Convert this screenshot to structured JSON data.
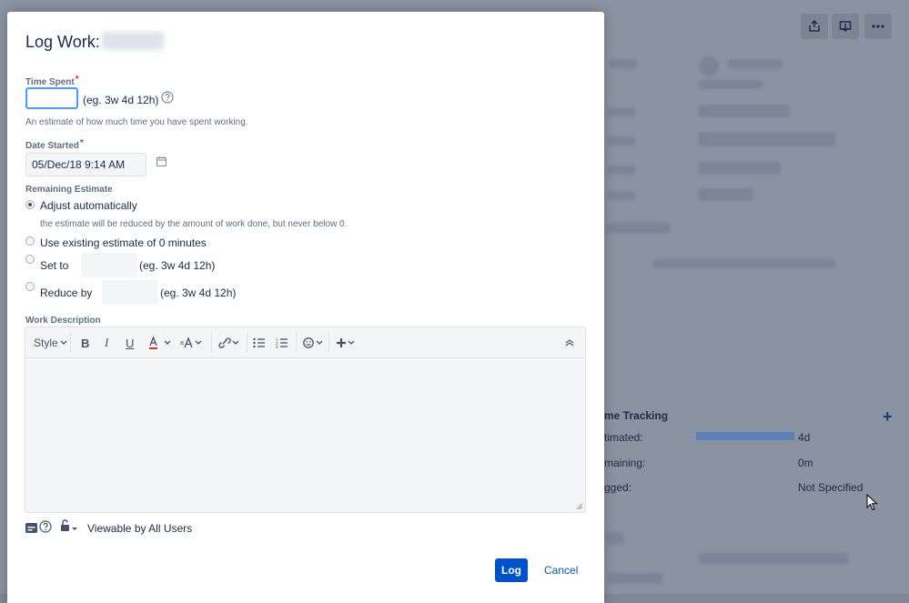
{
  "background": {
    "time_tracking_heading": "me Tracking",
    "rows": [
      {
        "label": "timated:",
        "value": "4d"
      },
      {
        "label": "maining:",
        "value": "0m"
      },
      {
        "label": "gged:",
        "value": "Not Specified"
      }
    ],
    "estimated_fill": 1.0
  },
  "dialog": {
    "title": "Log Work:",
    "time_spent": {
      "label": "Time Spent",
      "required_mark": "*",
      "value": "",
      "hint": "(eg. 3w 4d 12h)",
      "description": "An estimate of how much time you have spent working."
    },
    "date_started": {
      "label": "Date Started",
      "required_mark": "*",
      "value": "05/Dec/18 9:14 AM"
    },
    "remaining_estimate": {
      "label": "Remaining Estimate",
      "options": [
        {
          "label": "Adjust automatically",
          "checked": true
        },
        {
          "label": "Use existing estimate of 0 minutes",
          "checked": false
        },
        {
          "label": "Set to",
          "checked": false
        },
        {
          "label": "Reduce by",
          "checked": false
        }
      ],
      "adjust_note": "the estimate will be reduced by the amount of work done, but never below 0.",
      "set_hint": "(eg. 3w 4d 12h)",
      "reduce_hint": "(eg. 3w 4d 12h)"
    },
    "work_description": {
      "label": "Work Description",
      "toolbar": {
        "style_label": "Style",
        "icons": [
          "bold-icon",
          "italic-icon",
          "underline-icon",
          "text-color-icon",
          "text-effects-icon",
          "link-icon",
          "bullet-list-icon",
          "numbered-list-icon",
          "emoji-icon",
          "insert-more-icon",
          "collapse-icon"
        ]
      }
    },
    "visibility": "Viewable by All Users",
    "buttons": {
      "log": "Log",
      "cancel": "Cancel"
    }
  },
  "colors": {
    "primary": "#0052cc",
    "focus": "#4c9aff",
    "required": "#de350b"
  }
}
